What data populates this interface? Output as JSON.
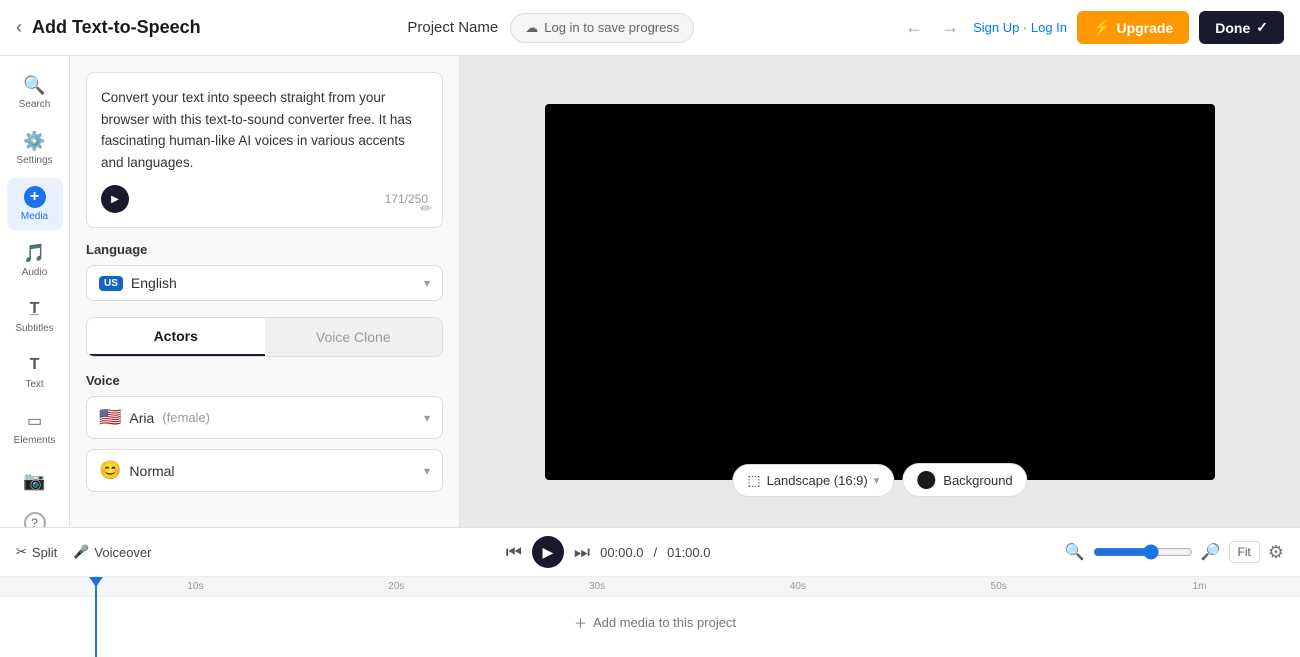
{
  "header": {
    "back_label": "‹",
    "title": "Add Text-to-Speech",
    "project_name": "Project Name",
    "save_progress": "Log in to save progress",
    "auth_text": "Sign Up · Log In",
    "upgrade_label": "Upgrade",
    "upgrade_icon": "⚡",
    "done_label": "Done",
    "done_icon": "✓",
    "undo_icon": "←",
    "redo_icon": "→"
  },
  "sidebar": {
    "items": [
      {
        "id": "search",
        "label": "Search",
        "icon": "🔍"
      },
      {
        "id": "settings",
        "label": "Settings",
        "icon": "⚙️"
      },
      {
        "id": "media",
        "label": "Media",
        "icon": "➕",
        "active": true
      },
      {
        "id": "audio",
        "label": "Audio",
        "icon": "🎵"
      },
      {
        "id": "subtitles",
        "label": "Subtitles",
        "icon": "T"
      },
      {
        "id": "text",
        "label": "Text",
        "icon": "T"
      },
      {
        "id": "elements",
        "label": "Elements",
        "icon": "▭"
      },
      {
        "id": "camera",
        "label": "Camera",
        "icon": "📷"
      },
      {
        "id": "help",
        "label": "?",
        "icon": "?"
      }
    ]
  },
  "panel": {
    "text_content": "Convert your text into speech straight from your browser with this text-to-sound converter free. It has fascinating human-like AI voices in various accents and languages.",
    "char_count": "171/250",
    "language_label": "Language",
    "language_flag": "US",
    "language_value": "English",
    "tabs": [
      {
        "id": "actors",
        "label": "Actors",
        "active": true
      },
      {
        "id": "voice_clone",
        "label": "Voice Clone",
        "active": false
      }
    ],
    "voice_label": "Voice",
    "voice_flag": "🇺🇸",
    "voice_name": "Aria",
    "voice_gender": "(female)",
    "style_emoji": "😊",
    "style_value": "Normal"
  },
  "video": {
    "landscape_label": "Landscape (16:9)",
    "landscape_icon": "⬜",
    "background_label": "Background"
  },
  "timeline": {
    "split_label": "Split",
    "voiceover_label": "Voiceover",
    "split_icon": "✂",
    "voiceover_icon": "🎤",
    "time_current": "00:00.0",
    "time_total": "01:00.0",
    "time_separator": "/",
    "fit_label": "Fit",
    "add_media_label": "Add media to this project",
    "ruler_marks": [
      "10s",
      "20s",
      "30s",
      "40s",
      "50s",
      "1m"
    ]
  }
}
